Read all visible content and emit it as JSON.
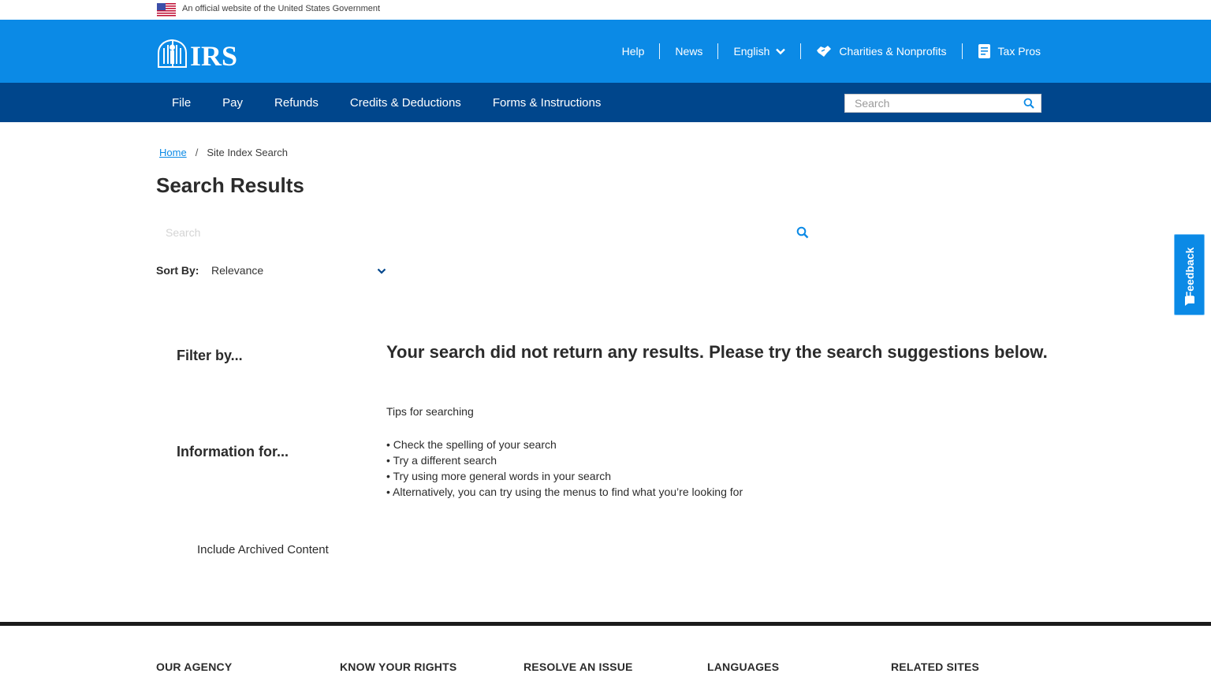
{
  "gov_banner": {
    "text": "An official website of the United States Government",
    "flag_icon": "us-flag-icon"
  },
  "header": {
    "logo_text": "IRS",
    "links": [
      {
        "label": "Help"
      },
      {
        "label": "News"
      },
      {
        "label": "English",
        "icon": "chevron-down-icon"
      },
      {
        "label": "Charities & Nonprofits",
        "icon": "handshake-icon"
      },
      {
        "label": "Tax Pros",
        "icon": "document-icon"
      }
    ],
    "colors": {
      "top": "#0b8ae6",
      "nav": "#00468c"
    }
  },
  "nav": {
    "items": [
      "File",
      "Pay",
      "Refunds",
      "Credits & Deductions",
      "Forms & Instructions"
    ],
    "search_placeholder": "Search"
  },
  "breadcrumb": {
    "home": "Home",
    "separator": "/",
    "current": "Site Index Search"
  },
  "page_title": "Search Results",
  "result_search": {
    "placeholder": "Search"
  },
  "sort": {
    "label": "Sort By:",
    "value": "Relevance"
  },
  "filters": {
    "filter_title": "Filter by...",
    "info_title": "Information for...",
    "archived_label": "Include Archived Content"
  },
  "results": {
    "no_results": "Your search did not return any results. Please try the search suggestions below.",
    "tips_title": "Tips for searching",
    "tips": [
      "• Check the spelling of your search",
      "• Try a different search",
      "• Try using more general words in your search",
      "• Alternatively, you can try using the menus to find what you’re looking for"
    ]
  },
  "feedback": {
    "label": "Feedback"
  },
  "footer": {
    "columns": [
      "OUR AGENCY",
      "KNOW YOUR RIGHTS",
      "RESOLVE AN ISSUE",
      "LANGUAGES",
      "RELATED SITES"
    ]
  }
}
